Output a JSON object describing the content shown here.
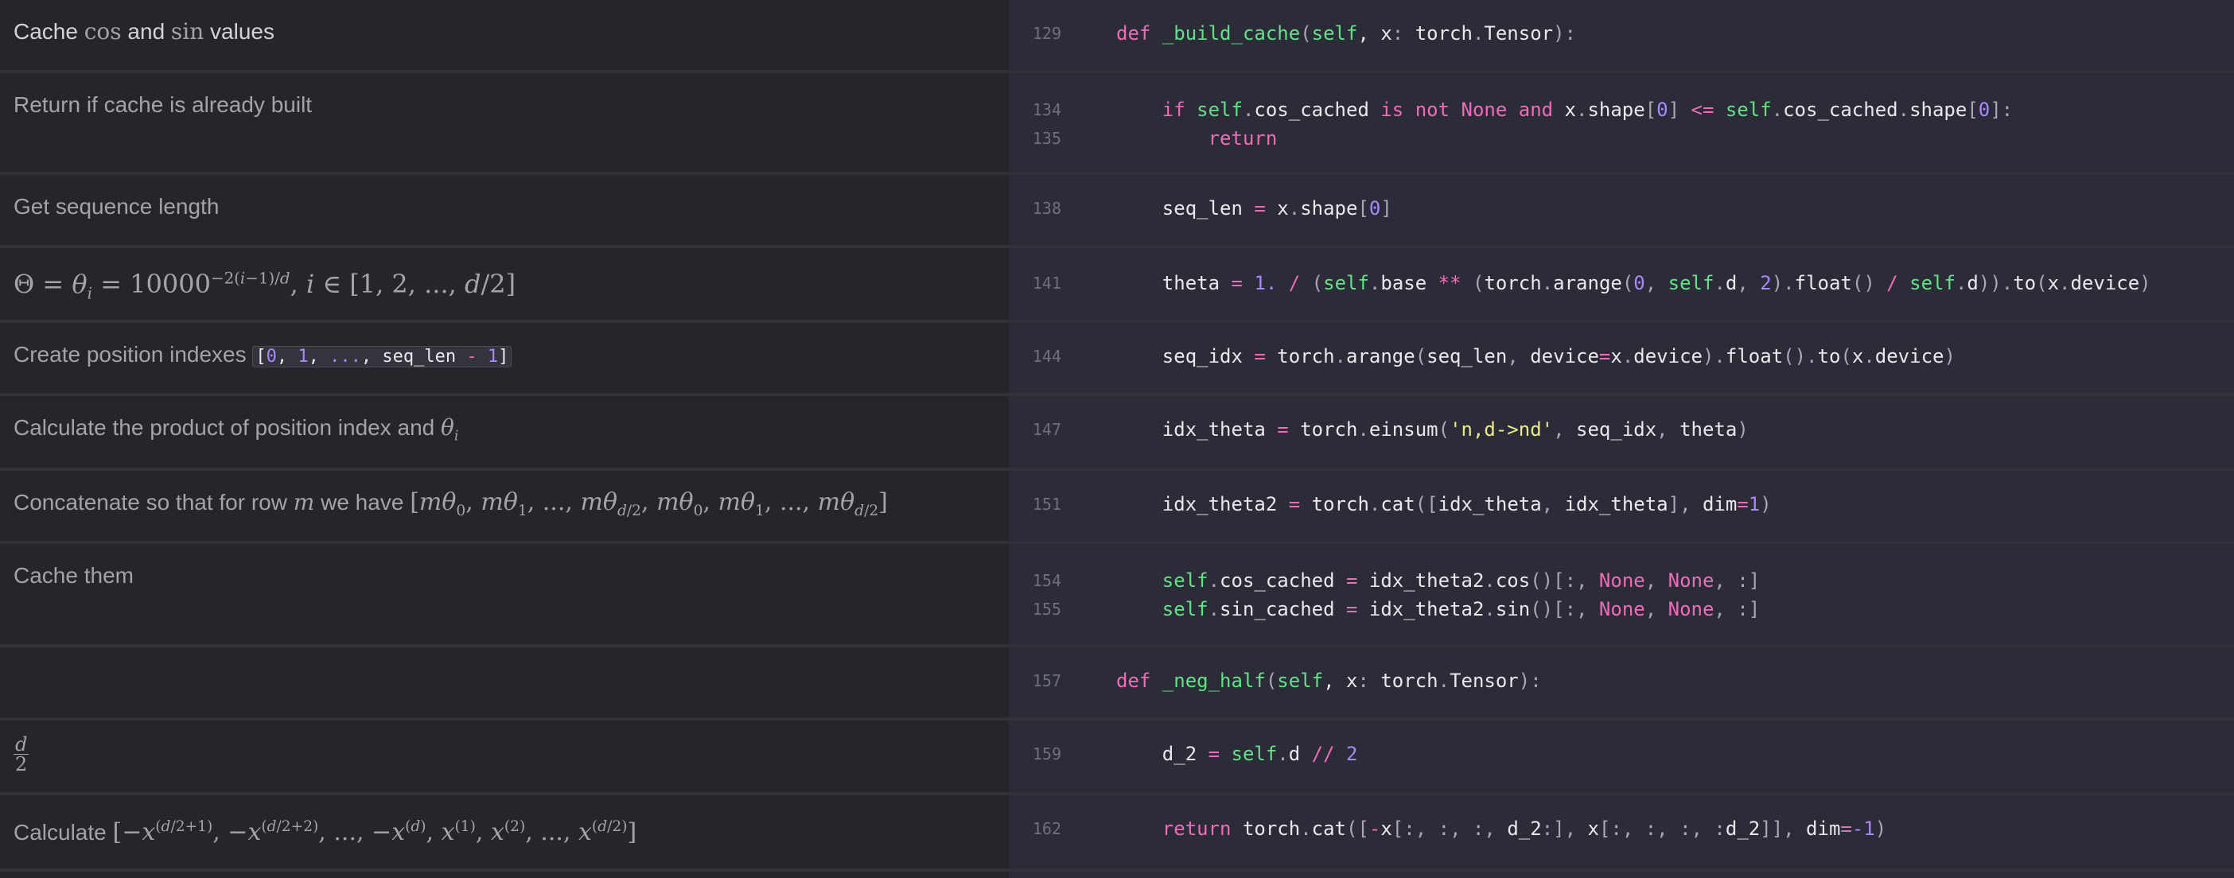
{
  "rows": [
    {
      "doc": "Cache cos and sin values",
      "lines": [
        {
          "n": "129",
          "segs": [
            {
              "c": "kw",
              "t": "def "
            },
            {
              "c": "fn",
              "t": "_build_cache"
            },
            {
              "c": "p",
              "t": "("
            },
            {
              "c": "slf",
              "t": "self"
            },
            {
              "c": "",
              "t": ", x"
            },
            {
              "c": "p",
              "t": ": "
            },
            {
              "c": "",
              "t": "torch"
            },
            {
              "c": "p",
              "t": "."
            },
            {
              "c": "",
              "t": "Tensor"
            },
            {
              "c": "p",
              "t": "):"
            }
          ]
        }
      ]
    },
    {
      "doc": "Return if cache is already built",
      "lines": [
        {
          "n": "134",
          "segs": [
            {
              "c": "",
              "t": "    "
            },
            {
              "c": "kw",
              "t": "if "
            },
            {
              "c": "slf",
              "t": "self"
            },
            {
              "c": "p",
              "t": "."
            },
            {
              "c": "",
              "t": "cos_cached "
            },
            {
              "c": "kw",
              "t": "is not None and "
            },
            {
              "c": "",
              "t": "x"
            },
            {
              "c": "p",
              "t": "."
            },
            {
              "c": "",
              "t": "shape"
            },
            {
              "c": "p",
              "t": "["
            },
            {
              "c": "num",
              "t": "0"
            },
            {
              "c": "p",
              "t": "]"
            },
            {
              "c": "op",
              "t": " <= "
            },
            {
              "c": "slf",
              "t": "self"
            },
            {
              "c": "p",
              "t": "."
            },
            {
              "c": "",
              "t": "cos_cached"
            },
            {
              "c": "p",
              "t": "."
            },
            {
              "c": "",
              "t": "shape"
            },
            {
              "c": "p",
              "t": "["
            },
            {
              "c": "num",
              "t": "0"
            },
            {
              "c": "p",
              "t": "]:"
            }
          ]
        },
        {
          "n": "135",
          "segs": [
            {
              "c": "",
              "t": "        "
            },
            {
              "c": "kw",
              "t": "return"
            }
          ]
        }
      ]
    },
    {
      "doc": "Get sequence length",
      "lines": [
        {
          "n": "138",
          "segs": [
            {
              "c": "",
              "t": "    seq_len "
            },
            {
              "c": "op",
              "t": "= "
            },
            {
              "c": "",
              "t": "x"
            },
            {
              "c": "p",
              "t": "."
            },
            {
              "c": "",
              "t": "shape"
            },
            {
              "c": "p",
              "t": "["
            },
            {
              "c": "num",
              "t": "0"
            },
            {
              "c": "p",
              "t": "]"
            }
          ]
        }
      ]
    },
    {
      "doc": "",
      "lines": [
        {
          "n": "141",
          "segs": [
            {
              "c": "",
              "t": "    theta "
            },
            {
              "c": "op",
              "t": "= "
            },
            {
              "c": "num",
              "t": "1."
            },
            {
              "c": "op",
              "t": " / "
            },
            {
              "c": "p",
              "t": "("
            },
            {
              "c": "slf",
              "t": "self"
            },
            {
              "c": "p",
              "t": "."
            },
            {
              "c": "",
              "t": "base "
            },
            {
              "c": "op",
              "t": "** "
            },
            {
              "c": "p",
              "t": "("
            },
            {
              "c": "",
              "t": "torch"
            },
            {
              "c": "p",
              "t": "."
            },
            {
              "c": "",
              "t": "arange"
            },
            {
              "c": "p",
              "t": "("
            },
            {
              "c": "num",
              "t": "0"
            },
            {
              "c": "p",
              "t": ", "
            },
            {
              "c": "slf",
              "t": "self"
            },
            {
              "c": "p",
              "t": "."
            },
            {
              "c": "",
              "t": "d"
            },
            {
              "c": "p",
              "t": ", "
            },
            {
              "c": "num",
              "t": "2"
            },
            {
              "c": "p",
              "t": ")."
            },
            {
              "c": "",
              "t": "float"
            },
            {
              "c": "p",
              "t": "()"
            },
            {
              "c": "op",
              "t": " / "
            },
            {
              "c": "slf",
              "t": "self"
            },
            {
              "c": "p",
              "t": "."
            },
            {
              "c": "",
              "t": "d"
            },
            {
              "c": "p",
              "t": "))."
            },
            {
              "c": "",
              "t": "to"
            },
            {
              "c": "p",
              "t": "("
            },
            {
              "c": "",
              "t": "x"
            },
            {
              "c": "p",
              "t": "."
            },
            {
              "c": "",
              "t": "device"
            },
            {
              "c": "p",
              "t": ")"
            }
          ]
        }
      ]
    },
    {
      "doc": "Create position indexes",
      "doc_code": "seq_len",
      "lines": [
        {
          "n": "144",
          "segs": [
            {
              "c": "",
              "t": "    seq_idx "
            },
            {
              "c": "op",
              "t": "= "
            },
            {
              "c": "",
              "t": "torch"
            },
            {
              "c": "p",
              "t": "."
            },
            {
              "c": "",
              "t": "arange"
            },
            {
              "c": "p",
              "t": "("
            },
            {
              "c": "",
              "t": "seq_len"
            },
            {
              "c": "p",
              "t": ", "
            },
            {
              "c": "",
              "t": "device"
            },
            {
              "c": "op",
              "t": "="
            },
            {
              "c": "",
              "t": "x"
            },
            {
              "c": "p",
              "t": "."
            },
            {
              "c": "",
              "t": "device"
            },
            {
              "c": "p",
              "t": ")."
            },
            {
              "c": "",
              "t": "float"
            },
            {
              "c": "p",
              "t": "()."
            },
            {
              "c": "",
              "t": "to"
            },
            {
              "c": "p",
              "t": "("
            },
            {
              "c": "",
              "t": "x"
            },
            {
              "c": "p",
              "t": "."
            },
            {
              "c": "",
              "t": "device"
            },
            {
              "c": "p",
              "t": ")"
            }
          ]
        }
      ]
    },
    {
      "doc": "Calculate the product of position index and",
      "lines": [
        {
          "n": "147",
          "segs": [
            {
              "c": "",
              "t": "    idx_theta "
            },
            {
              "c": "op",
              "t": "= "
            },
            {
              "c": "",
              "t": "torch"
            },
            {
              "c": "p",
              "t": "."
            },
            {
              "c": "",
              "t": "einsum"
            },
            {
              "c": "p",
              "t": "("
            },
            {
              "c": "str",
              "t": "'n,d->nd'"
            },
            {
              "c": "p",
              "t": ", "
            },
            {
              "c": "",
              "t": "seq_idx"
            },
            {
              "c": "p",
              "t": ", "
            },
            {
              "c": "",
              "t": "theta"
            },
            {
              "c": "p",
              "t": ")"
            }
          ]
        }
      ]
    },
    {
      "doc": "Concatenate so that for row",
      "doc_mid": "we have",
      "lines": [
        {
          "n": "151",
          "segs": [
            {
              "c": "",
              "t": "    idx_theta2 "
            },
            {
              "c": "op",
              "t": "= "
            },
            {
              "c": "",
              "t": "torch"
            },
            {
              "c": "p",
              "t": "."
            },
            {
              "c": "",
              "t": "cat"
            },
            {
              "c": "p",
              "t": "(["
            },
            {
              "c": "",
              "t": "idx_theta"
            },
            {
              "c": "p",
              "t": ", "
            },
            {
              "c": "",
              "t": "idx_theta"
            },
            {
              "c": "p",
              "t": "], "
            },
            {
              "c": "",
              "t": "dim"
            },
            {
              "c": "op",
              "t": "="
            },
            {
              "c": "num",
              "t": "1"
            },
            {
              "c": "p",
              "t": ")"
            }
          ]
        }
      ]
    },
    {
      "doc": "Cache them",
      "lines": [
        {
          "n": "154",
          "segs": [
            {
              "c": "",
              "t": "    "
            },
            {
              "c": "slf",
              "t": "self"
            },
            {
              "c": "p",
              "t": "."
            },
            {
              "c": "",
              "t": "cos_cached "
            },
            {
              "c": "op",
              "t": "= "
            },
            {
              "c": "",
              "t": "idx_theta2"
            },
            {
              "c": "p",
              "t": "."
            },
            {
              "c": "",
              "t": "cos"
            },
            {
              "c": "p",
              "t": "()[:, "
            },
            {
              "c": "nn",
              "t": "None"
            },
            {
              "c": "p",
              "t": ", "
            },
            {
              "c": "nn",
              "t": "None"
            },
            {
              "c": "p",
              "t": ", :]"
            }
          ]
        },
        {
          "n": "155",
          "segs": [
            {
              "c": "",
              "t": "    "
            },
            {
              "c": "slf",
              "t": "self"
            },
            {
              "c": "p",
              "t": "."
            },
            {
              "c": "",
              "t": "sin_cached "
            },
            {
              "c": "op",
              "t": "= "
            },
            {
              "c": "",
              "t": "idx_theta2"
            },
            {
              "c": "p",
              "t": "."
            },
            {
              "c": "",
              "t": "sin"
            },
            {
              "c": "p",
              "t": "()[:, "
            },
            {
              "c": "nn",
              "t": "None"
            },
            {
              "c": "p",
              "t": ", "
            },
            {
              "c": "nn",
              "t": "None"
            },
            {
              "c": "p",
              "t": ", :]"
            }
          ]
        }
      ]
    },
    {
      "doc": "",
      "lines": [
        {
          "n": "157",
          "segs": [
            {
              "c": "kw",
              "t": "def "
            },
            {
              "c": "fn",
              "t": "_neg_half"
            },
            {
              "c": "p",
              "t": "("
            },
            {
              "c": "slf",
              "t": "self"
            },
            {
              "c": "",
              "t": ", x"
            },
            {
              "c": "p",
              "t": ": "
            },
            {
              "c": "",
              "t": "torch"
            },
            {
              "c": "p",
              "t": "."
            },
            {
              "c": "",
              "t": "Tensor"
            },
            {
              "c": "p",
              "t": "):"
            }
          ]
        }
      ]
    },
    {
      "doc": "",
      "lines": [
        {
          "n": "159",
          "segs": [
            {
              "c": "",
              "t": "    d_2 "
            },
            {
              "c": "op",
              "t": "= "
            },
            {
              "c": "slf",
              "t": "self"
            },
            {
              "c": "p",
              "t": "."
            },
            {
              "c": "",
              "t": "d "
            },
            {
              "c": "op",
              "t": "// "
            },
            {
              "c": "num",
              "t": "2"
            }
          ]
        }
      ]
    },
    {
      "doc": "Calculate",
      "lines": [
        {
          "n": "162",
          "segs": [
            {
              "c": "",
              "t": "    "
            },
            {
              "c": "kw",
              "t": "return "
            },
            {
              "c": "",
              "t": "torch"
            },
            {
              "c": "p",
              "t": "."
            },
            {
              "c": "",
              "t": "cat"
            },
            {
              "c": "p",
              "t": "(["
            },
            {
              "c": "op",
              "t": "-"
            },
            {
              "c": "",
              "t": "x"
            },
            {
              "c": "p",
              "t": "[:, :, :, "
            },
            {
              "c": "",
              "t": "d_2"
            },
            {
              "c": "p",
              "t": ":], "
            },
            {
              "c": "",
              "t": "x"
            },
            {
              "c": "p",
              "t": "[:, :, :, :"
            },
            {
              "c": "",
              "t": "d_2"
            },
            {
              "c": "p",
              "t": "]], "
            },
            {
              "c": "",
              "t": "dim"
            },
            {
              "c": "op",
              "t": "="
            },
            {
              "c": "num",
              "t": "-1"
            },
            {
              "c": "p",
              "t": ")"
            }
          ]
        }
      ]
    }
  ]
}
